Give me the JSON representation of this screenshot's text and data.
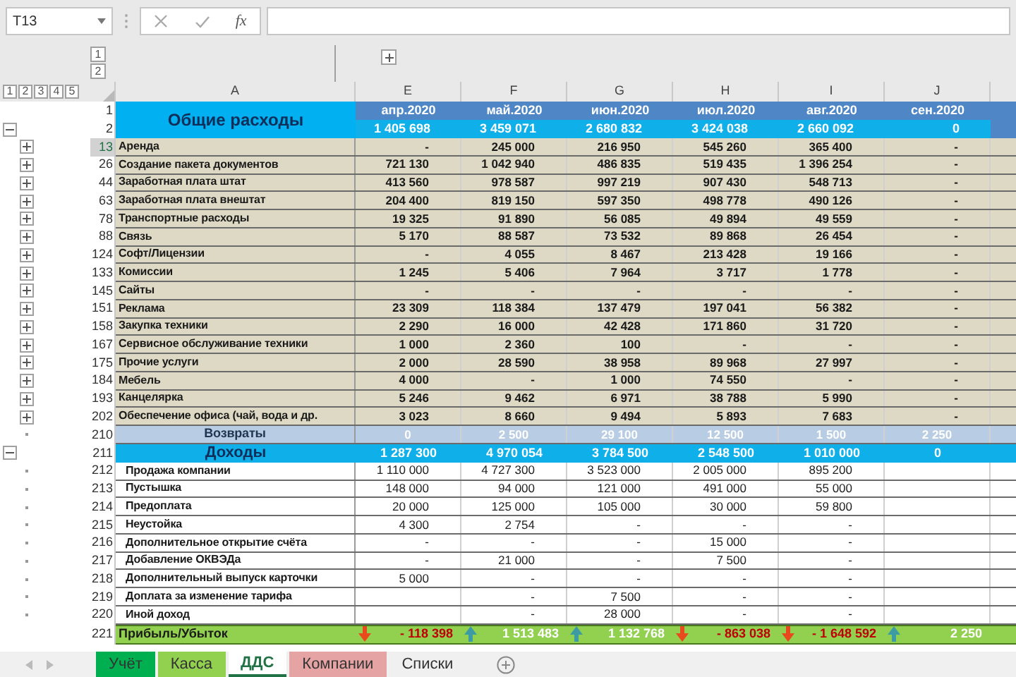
{
  "name_box": "T13",
  "function_label": "fx",
  "outline": {
    "row_levels": [
      "1",
      "2",
      "3",
      "4",
      "5"
    ],
    "column_levels": [
      "1",
      "2"
    ]
  },
  "columns": [
    "A",
    "E",
    "F",
    "G",
    "H",
    "I",
    "J"
  ],
  "header": {
    "rows": [
      "1",
      "2"
    ],
    "title": "Общие расходы",
    "months": [
      "апр.2020",
      "май.2020",
      "июн.2020",
      "июл.2020",
      "авг.2020",
      "сен.2020"
    ],
    "totals": [
      "1 405 698",
      "3 459 071",
      "2 680 832",
      "3 424 038",
      "2 660 092",
      "0"
    ],
    "expanded": true
  },
  "expenses": [
    {
      "num": "13",
      "label": "Аренда",
      "values": [
        "-",
        "245 000",
        "216 950",
        "545 260",
        "365 400",
        "-"
      ],
      "selected": true
    },
    {
      "num": "26",
      "label": "Создание пакета документов",
      "values": [
        "721 130",
        "1 042 940",
        "486 835",
        "519 435",
        "1 396 254",
        "-"
      ],
      "selected": false
    },
    {
      "num": "44",
      "label": "Заработная плата штат",
      "values": [
        "413 560",
        "978 587",
        "997 219",
        "907 430",
        "548 713",
        "-"
      ],
      "selected": false
    },
    {
      "num": "63",
      "label": "Заработная плата внештат",
      "values": [
        "204 400",
        "819 150",
        "597 350",
        "498 778",
        "490 126",
        "-"
      ],
      "selected": false
    },
    {
      "num": "78",
      "label": "Транспортные расходы",
      "values": [
        "19 325",
        "91 890",
        "56 085",
        "49 894",
        "49 559",
        "-"
      ],
      "selected": false
    },
    {
      "num": "88",
      "label": "Связь",
      "values": [
        "5 170",
        "88 587",
        "73 532",
        "89 868",
        "26 454",
        "-"
      ],
      "selected": false
    },
    {
      "num": "124",
      "label": "Софт/Лицензии",
      "values": [
        "-",
        "4 055",
        "8 467",
        "213 428",
        "19 166",
        "-"
      ],
      "selected": false
    },
    {
      "num": "133",
      "label": "Комиссии",
      "values": [
        "1 245",
        "5 406",
        "7 964",
        "3 717",
        "1 778",
        "-"
      ],
      "selected": false
    },
    {
      "num": "145",
      "label": "Сайты",
      "values": [
        "-",
        "-",
        "-",
        "-",
        "-",
        "-"
      ],
      "selected": false
    },
    {
      "num": "151",
      "label": "Реклама",
      "values": [
        "23 309",
        "118 384",
        "137 479",
        "197 041",
        "56 382",
        "-"
      ],
      "selected": false
    },
    {
      "num": "158",
      "label": "Закупка техники",
      "values": [
        "2 290",
        "16 000",
        "42 428",
        "171 860",
        "31 720",
        "-"
      ],
      "selected": false
    },
    {
      "num": "167",
      "label": "Сервисное обслуживание техники",
      "values": [
        "1 000",
        "2 360",
        "100",
        "-",
        "-",
        "-"
      ],
      "selected": false
    },
    {
      "num": "175",
      "label": "Прочие услуги",
      "values": [
        "2 000",
        "28 590",
        "38 958",
        "89 968",
        "27 997",
        "-"
      ],
      "selected": false
    },
    {
      "num": "184",
      "label": "Мебель",
      "values": [
        "4 000",
        "-",
        "1 000",
        "74 550",
        "-",
        "-"
      ],
      "selected": false
    },
    {
      "num": "193",
      "label": "Канцелярка",
      "values": [
        "5 246",
        "9 462",
        "6 971",
        "38 788",
        "5 990",
        "-"
      ],
      "selected": false
    },
    {
      "num": "202",
      "label": "Обеспечение офиса (чай, вода и др.",
      "values": [
        "3 023",
        "8 660",
        "9 494",
        "5 893",
        "7 683",
        "-"
      ],
      "selected": false
    }
  ],
  "returns": {
    "num": "210",
    "label": "Возвраты",
    "values": [
      "0",
      "2 500",
      "29 100",
      "12 500",
      "1 500",
      "2 250"
    ]
  },
  "income": {
    "num": "211",
    "label": "Доходы",
    "values": [
      "1 287 300",
      "4 970 054",
      "3 784 500",
      "2 548 500",
      "1 010 000",
      "0"
    ],
    "expanded": true
  },
  "income_rows": [
    {
      "num": "212",
      "label": "Продажа компании",
      "cells": {
        "E": "1 110 000",
        "F": "4 727 300",
        "G": "3 523 000",
        "H": "2 005 000",
        "I": "895 200"
      }
    },
    {
      "num": "213",
      "label": "Пустышка",
      "cells": {
        "E": "148 000",
        "F": "94 000",
        "G": "121 000",
        "H": "491 000",
        "I": "55 000"
      }
    },
    {
      "num": "214",
      "label": "Предоплата",
      "cells": {
        "E": "20 000",
        "F": "125 000",
        "G": "105 000",
        "H": "30 000",
        "I": "59 800"
      }
    },
    {
      "num": "215",
      "label": "Неустойка",
      "cells": {
        "E": "4 300",
        "F": "2 754",
        "G": "-",
        "H": "-",
        "I": "-"
      }
    },
    {
      "num": "216",
      "label": "Дополнительное открытие счёта",
      "cells": {
        "E": "-",
        "F": "-",
        "G": "-",
        "H": "15 000",
        "I": "-"
      }
    },
    {
      "num": "217",
      "label": "Добавление ОКВЭДа",
      "cells": {
        "E": "-",
        "F": "21 000",
        "G": "-",
        "H": "7 500",
        "I": "-"
      }
    },
    {
      "num": "218",
      "label": "Дополнительный выпуск карточки",
      "cells": {
        "E": "5 000",
        "F": "-",
        "G": "-",
        "H": "-",
        "I": "-"
      }
    },
    {
      "num": "219",
      "label": "Доплата за изменение тарифа",
      "cells": {
        "F": "-",
        "G": "7 500",
        "H": "-",
        "I": "-"
      }
    },
    {
      "num": "220",
      "label": "Иной доход",
      "cells": {
        "F": "-",
        "G": "28 000",
        "H": "-",
        "I": "-"
      }
    }
  ],
  "profit": {
    "num": "221",
    "label": "Прибыль/Убыток",
    "values": [
      {
        "text": "- 118 398",
        "kind": "loss"
      },
      {
        "text": "1 513 483",
        "kind": "gain"
      },
      {
        "text": "1 132 768",
        "kind": "gain"
      },
      {
        "text": "- 863 038",
        "kind": "loss"
      },
      {
        "text": "- 1 648 592",
        "kind": "loss"
      },
      {
        "text": "2 250",
        "kind": "gain"
      }
    ]
  },
  "sheet_tabs": [
    {
      "label": "Учёт",
      "color": "#00b050",
      "selected": false
    },
    {
      "label": "Касса",
      "color": "#92d050",
      "selected": false
    },
    {
      "label": "ДДС",
      "color": "#ffffff",
      "selected": true
    },
    {
      "label": "Компании",
      "color": "#e6a3a3",
      "selected": false
    },
    {
      "label": "Списки",
      "color": "#f0f0f0",
      "selected": false
    }
  ]
}
